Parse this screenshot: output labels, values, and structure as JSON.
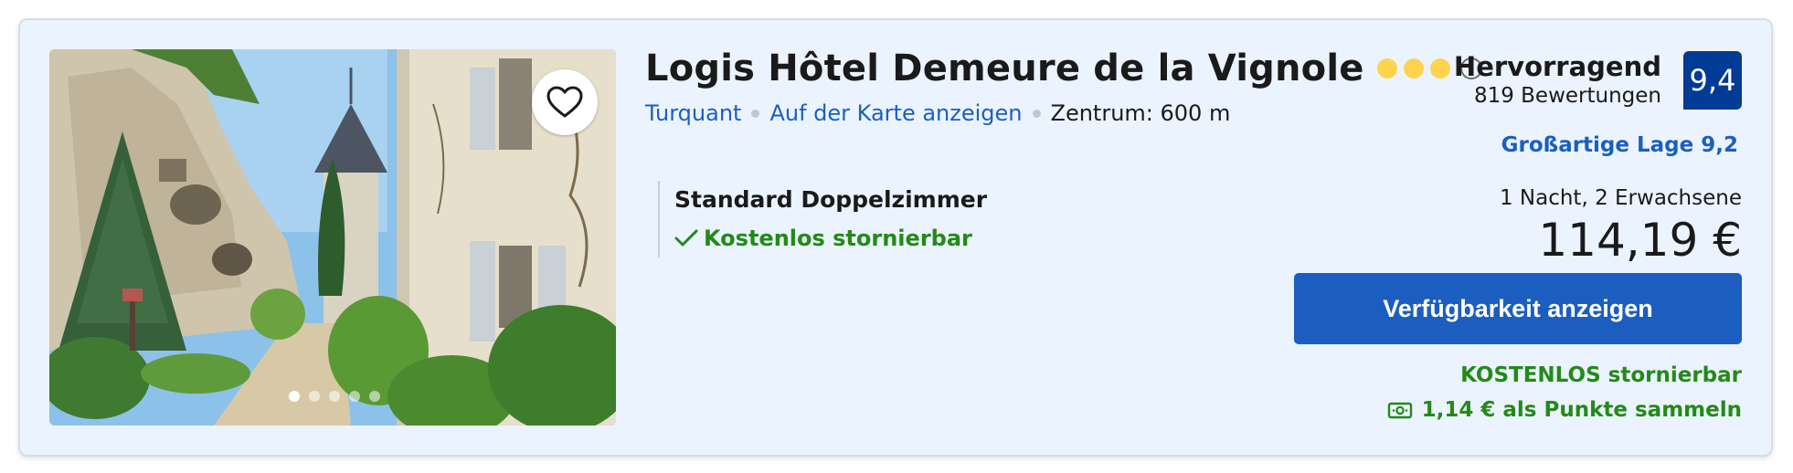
{
  "hotel": {
    "name": "Logis Hôtel Demeure de la Vignole",
    "stars": 3,
    "star_color": "#ffd44d",
    "town": "Turquant",
    "map_link": "Auf der Karte anzeigen",
    "distance": "Zentrum: 600 m",
    "photo_count": 5,
    "active_photo": 1
  },
  "room": {
    "name": "Standard Doppelzimmer",
    "cancellation": "Kostenlos stornierbar"
  },
  "rating": {
    "word": "Hervorragend",
    "reviews": "819 Bewertungen",
    "score": "9,4",
    "location": "Großartige Lage 9,2",
    "badge_color": "#003b95"
  },
  "pricing": {
    "occupancy": "1 Nacht, 2 Erwachsene",
    "price": "114,19 €",
    "cta": "Verfügbarkeit anzeigen",
    "free_cancel": "KOSTENLOS stornierbar",
    "points": "1,14 € als Punkte sammeln"
  },
  "icons": {
    "favorite": "heart-icon",
    "info": "info-icon",
    "check": "check-icon",
    "points": "cash-icon"
  },
  "colors": {
    "card_bg": "#ebf3ff",
    "link": "#1b5fbe",
    "button": "#1b5ebf",
    "green": "#238a17"
  }
}
